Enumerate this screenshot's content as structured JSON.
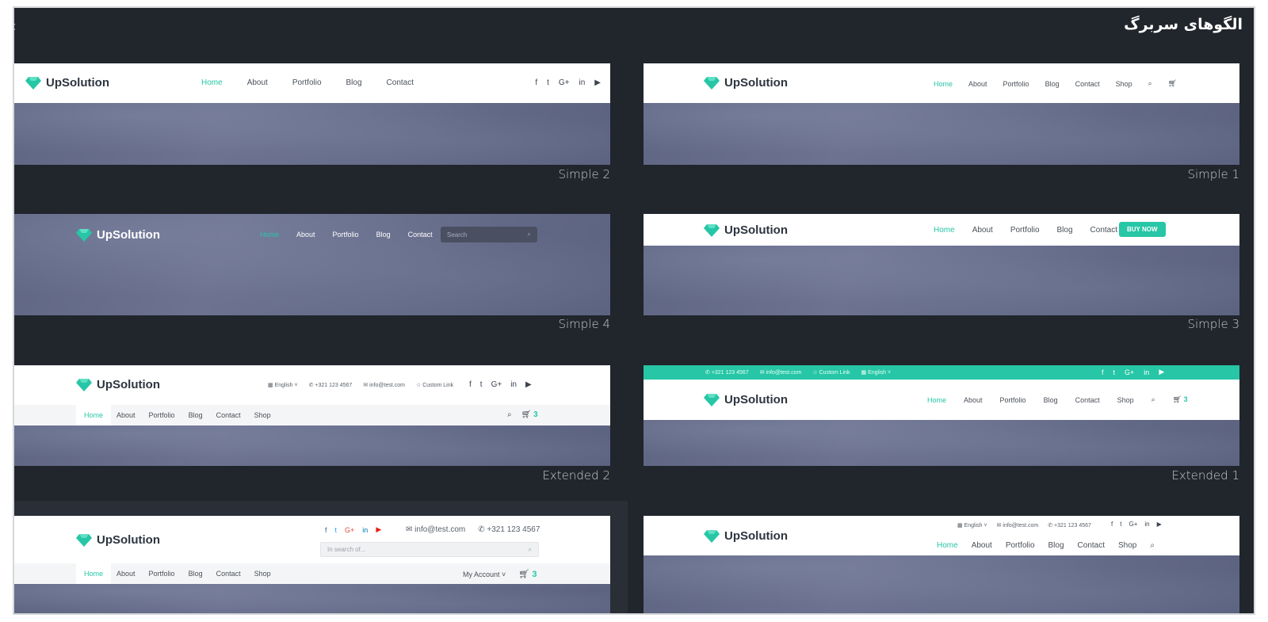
{
  "page": {
    "title": "الگوهای سربرگ"
  },
  "brand": "UpSolution",
  "nav_basic": [
    "Home",
    "About",
    "Portfolio",
    "Blog",
    "Contact"
  ],
  "nav_shop": [
    "Home",
    "About",
    "Portfolio",
    "Blog",
    "Contact",
    "Shop"
  ],
  "social_icons": [
    "facebook-icon",
    "twitter-icon",
    "google-plus-icon",
    "linkedin-icon",
    "youtube-icon"
  ],
  "contact": {
    "phone": "+321 123 4567",
    "email": "info@test.com",
    "custom_link": "Custom Link",
    "language": "English"
  },
  "search": {
    "dark_placeholder": "Search",
    "light_placeholder": "In search of..."
  },
  "cart_count": "3",
  "buy_now": "BUY NOW",
  "my_account": "My Account",
  "social_glyphs": [
    "f",
    "t",
    "G+",
    "in",
    "▶"
  ],
  "templates": [
    {
      "caption": "Simple 2"
    },
    {
      "caption": "Simple 1"
    },
    {
      "caption": "Simple 4"
    },
    {
      "caption": "Simple 3"
    },
    {
      "caption": "Extended 2"
    },
    {
      "caption": "Extended 1"
    }
  ],
  "colors": {
    "accent": "#26c6a6",
    "background": "#21252c",
    "header_bg": "#ffffff"
  }
}
